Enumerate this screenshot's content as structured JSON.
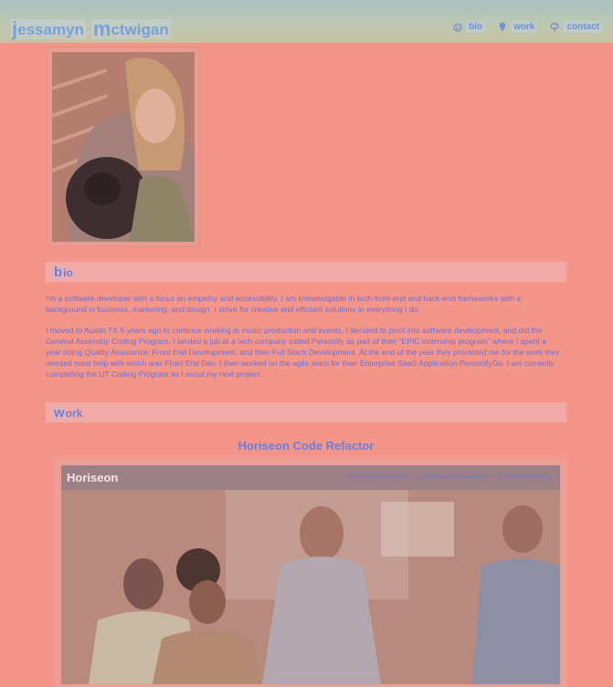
{
  "header": {
    "brand_first_initial": "j",
    "brand_first_rest": "essamyn",
    "brand_last_initial": "m",
    "brand_last_rest": "ctwigan",
    "nav": [
      {
        "icon": "smile-icon",
        "label": "bio"
      },
      {
        "icon": "lightbulb-icon",
        "label": "work"
      },
      {
        "icon": "mailbox-icon",
        "label": "contact"
      }
    ]
  },
  "profile": {
    "photo_alt": "portrait photo"
  },
  "bio": {
    "title_initial": "b",
    "title_rest": "io",
    "paragraphs": [
      "I'm a software developer with a focus on empathy and accessibility. I am knowledgable in both front-end and back-end frameworks with a background in business, marketing, and design. I strive for creative and efficiant solutions in everything I do.",
      "I moved to Austin TX 6 years ago to continue working in music production and events, I decided to pivot into software development, and did the General Assembly Coding Program. I landed a job at a tech company called Personify as part of their \"EPIC internship program\" where I spent a year doing Quality Assurance, Front End Development, and then Full Stack Development. At the end of the year they promoted me for the work they needed most help with which was Front End Dev. I then worked on the agile team for their Enterprise SaaS Application PersonifyGo. I am currently completing the UT Coding Program as I scout my next project."
    ]
  },
  "work": {
    "title_initial": "w",
    "title_rest": "ork",
    "projects": [
      {
        "title": "Horiseon Code Refactor",
        "screenshot": {
          "logo": "Horiseon",
          "nav": [
            "Search Engine Optimization",
            "Online Reputation Management",
            "Social Media Marketing"
          ]
        }
      }
    ]
  }
}
